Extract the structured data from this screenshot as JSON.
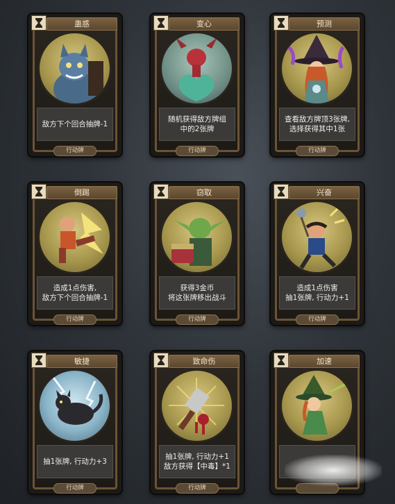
{
  "cards": [
    {
      "title": "蛊惑",
      "desc": "敌方下个回合抽牌-1",
      "tag": "行动牌",
      "art": "werewolf"
    },
    {
      "title": "变心",
      "desc": "随机获得敌方牌组\n中的2张牌",
      "tag": "行动牌",
      "art": "imp-heart"
    },
    {
      "title": "预测",
      "desc": "查看敌方牌顶3张牌,\n选择获得其中1张",
      "tag": "行动牌",
      "art": "witch"
    },
    {
      "title": "倒踢",
      "desc": "造成1点伤害,\n敌方下个回合抽牌-1",
      "tag": "行动牌",
      "art": "kicker"
    },
    {
      "title": "窃取",
      "desc": "获得3金币\n将这张牌移出战斗",
      "tag": "行动牌",
      "art": "goblin"
    },
    {
      "title": "兴奋",
      "desc": "造成1点伤害\n抽1张牌, 行动力+1",
      "tag": "行动牌",
      "art": "dancer"
    },
    {
      "title": "敏捷",
      "desc": "抽1张牌, 行动力+3",
      "tag": "行动牌",
      "art": "cat"
    },
    {
      "title": "致命伤",
      "desc": "抽1张牌, 行动力+1\n敌方获得【中毒】*1",
      "tag": "行动牌",
      "art": "cleaver"
    },
    {
      "title": "加速",
      "desc": "",
      "tag": "",
      "art": "green-witch"
    }
  ],
  "type_icon": "hourglass-icon"
}
